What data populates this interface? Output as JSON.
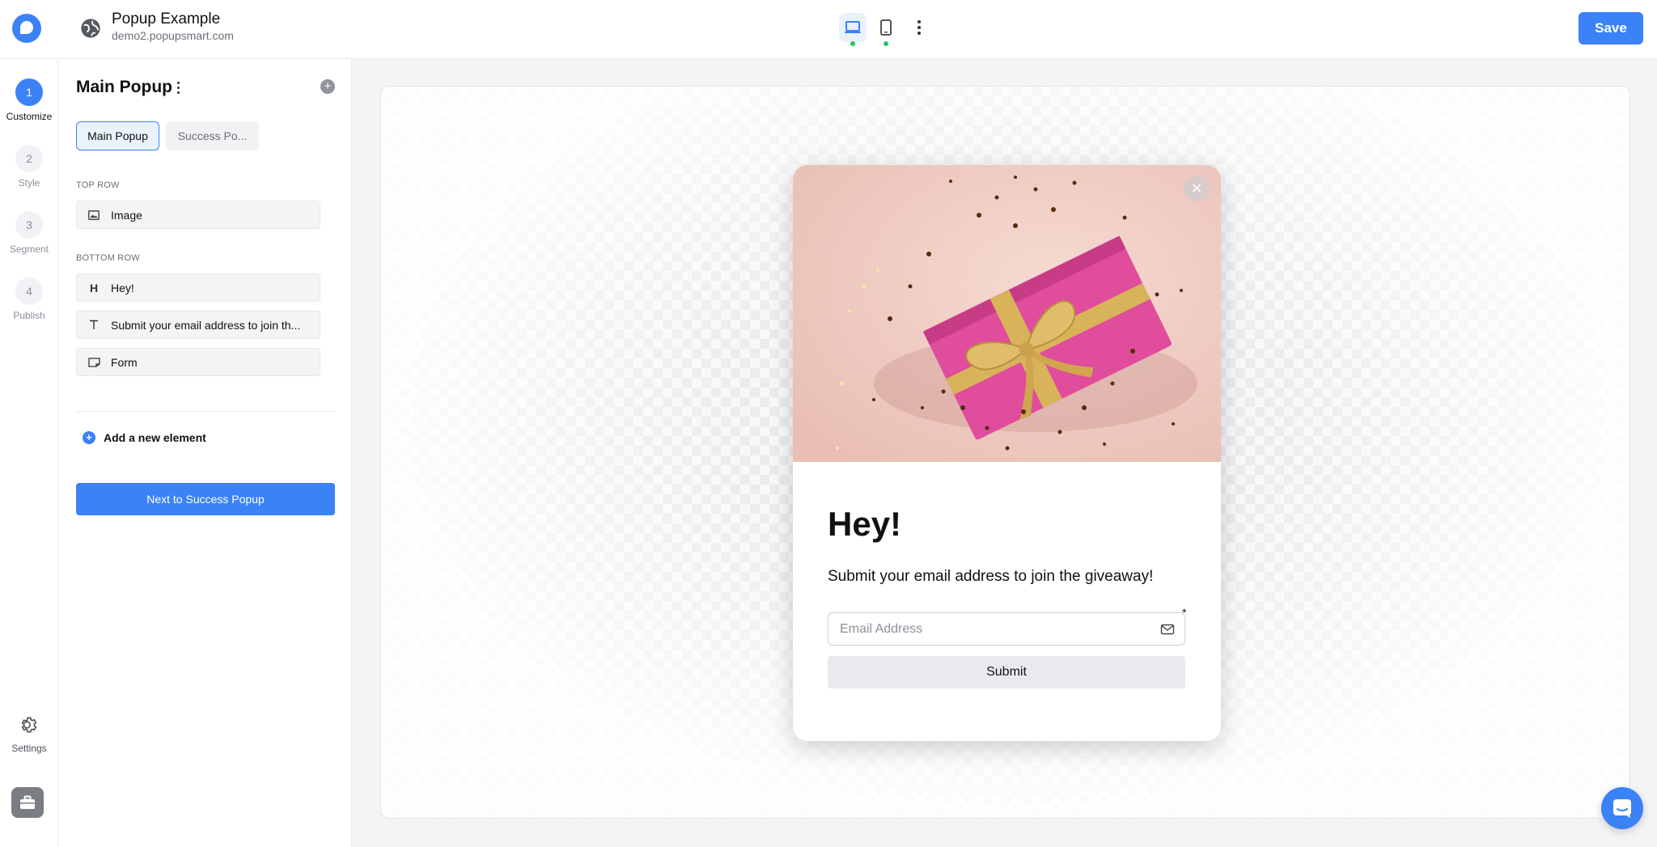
{
  "header": {
    "title": "Popup Example",
    "domain": "demo2.popupsmart.com",
    "save_label": "Save"
  },
  "steps": [
    {
      "number": "1",
      "label": "Customize",
      "active": true
    },
    {
      "number": "2",
      "label": "Style",
      "active": false
    },
    {
      "number": "3",
      "label": "Segment",
      "active": false
    },
    {
      "number": "4",
      "label": "Publish",
      "active": false
    }
  ],
  "rail": {
    "settings_label": "Settings"
  },
  "panel": {
    "title": "Main Popup",
    "tabs": [
      {
        "label": "Main Popup",
        "active": true
      },
      {
        "label": "Success Po...",
        "active": false
      }
    ],
    "top_row_label": "TOP ROW",
    "top_row_items": [
      {
        "icon": "image-icon",
        "label": "Image"
      }
    ],
    "bottom_row_label": "BOTTOM ROW",
    "bottom_row_items": [
      {
        "icon": "heading-icon",
        "label": "Hey!"
      },
      {
        "icon": "text-icon",
        "label": "Submit your email address to join th..."
      },
      {
        "icon": "form-icon",
        "label": "Form"
      }
    ],
    "add_element_label": "Add a new element",
    "next_button_label": "Next to Success Popup"
  },
  "popup": {
    "heading": "Hey!",
    "text": "Submit your email address to join the giveaway!",
    "email_placeholder": "Email Address",
    "required_mark": "*",
    "submit_label": "Submit",
    "close_glyph": "×"
  },
  "colors": {
    "accent": "#3b82f6",
    "gift_pink": "#e04d9c",
    "ribbon_gold": "#d8b35a",
    "photo_bg": "#f1cdc4"
  }
}
